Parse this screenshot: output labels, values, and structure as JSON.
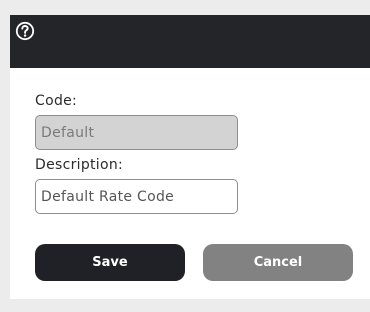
{
  "header": {
    "help_icon": "question-circle-icon",
    "background": "#232529"
  },
  "form": {
    "code": {
      "label": "Code:",
      "value": "Default",
      "disabled": true
    },
    "description": {
      "label": "Description:",
      "value": "Default Rate Code"
    }
  },
  "buttons": {
    "save_label": "Save",
    "cancel_label": "Cancel",
    "save_color": "#1f2126",
    "cancel_color": "#828282"
  }
}
